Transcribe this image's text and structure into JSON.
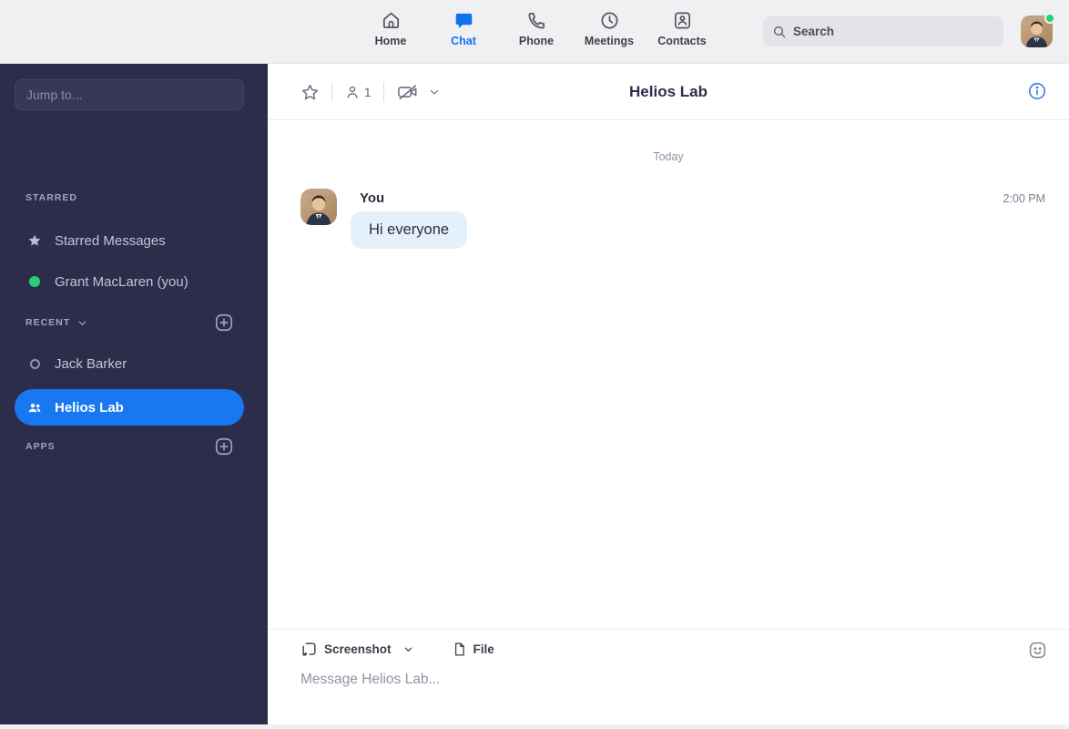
{
  "topbar": {
    "nav": [
      {
        "label": "Home",
        "active": false
      },
      {
        "label": "Chat",
        "active": true
      },
      {
        "label": "Phone",
        "active": false
      },
      {
        "label": "Meetings",
        "active": false
      },
      {
        "label": "Contacts",
        "active": false
      }
    ],
    "search_placeholder": "Search",
    "user_presence": "online"
  },
  "sidebar": {
    "jump_placeholder": "Jump to...",
    "starred": {
      "header": "STARRED",
      "items": [
        {
          "label": "Starred Messages",
          "icon": "star"
        },
        {
          "label": "Grant MacLaren (you)",
          "icon": "online-dot"
        }
      ]
    },
    "recent": {
      "header": "RECENT",
      "items": [
        {
          "label": "Jack Barker",
          "icon": "offline-circle",
          "selected": false
        },
        {
          "label": "Helios Lab",
          "icon": "group",
          "selected": true
        }
      ]
    },
    "apps": {
      "header": "APPS"
    }
  },
  "chat": {
    "title": "Helios Lab",
    "member_count": "1",
    "date_divider": "Today",
    "messages": [
      {
        "sender": "You",
        "time": "2:00 PM",
        "text": "Hi everyone"
      }
    ]
  },
  "composer": {
    "screenshot_label": "Screenshot",
    "file_label": "File",
    "placeholder": "Message Helios Lab..."
  },
  "colors": {
    "accent_blue": "#0E72ED",
    "selection_blue": "#1778F2",
    "sidebar_bg": "#2B2D4B",
    "bubble_bg": "#E4F1FB",
    "presence_green": "#2ECC71"
  }
}
